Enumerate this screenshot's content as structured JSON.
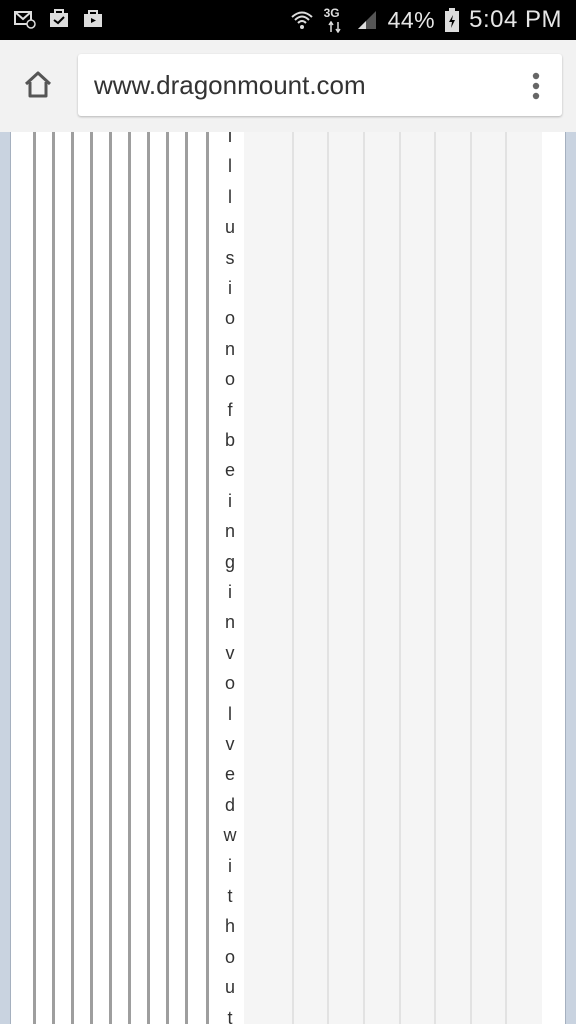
{
  "status_bar": {
    "network": "3G",
    "battery": "44%",
    "time": "5:04 PM",
    "icons": [
      "email-icon",
      "task-check-icon",
      "briefcase-icon",
      "wifi-icon",
      "signal-icon",
      "battery-icon"
    ]
  },
  "browser": {
    "url": "www.dragonmount.com",
    "icons": [
      "home-icon",
      "overflow-menu-icon"
    ]
  },
  "content": {
    "vertical_text": [
      "I",
      "l",
      "l",
      "u",
      "s",
      "i",
      "o",
      "n",
      "o",
      "f",
      "b",
      "e",
      "i",
      "n",
      "g",
      "i",
      "n",
      "v",
      "o",
      "l",
      "v",
      "e",
      "d",
      "w",
      "i",
      "t",
      "h",
      "o",
      "u",
      "t"
    ]
  }
}
